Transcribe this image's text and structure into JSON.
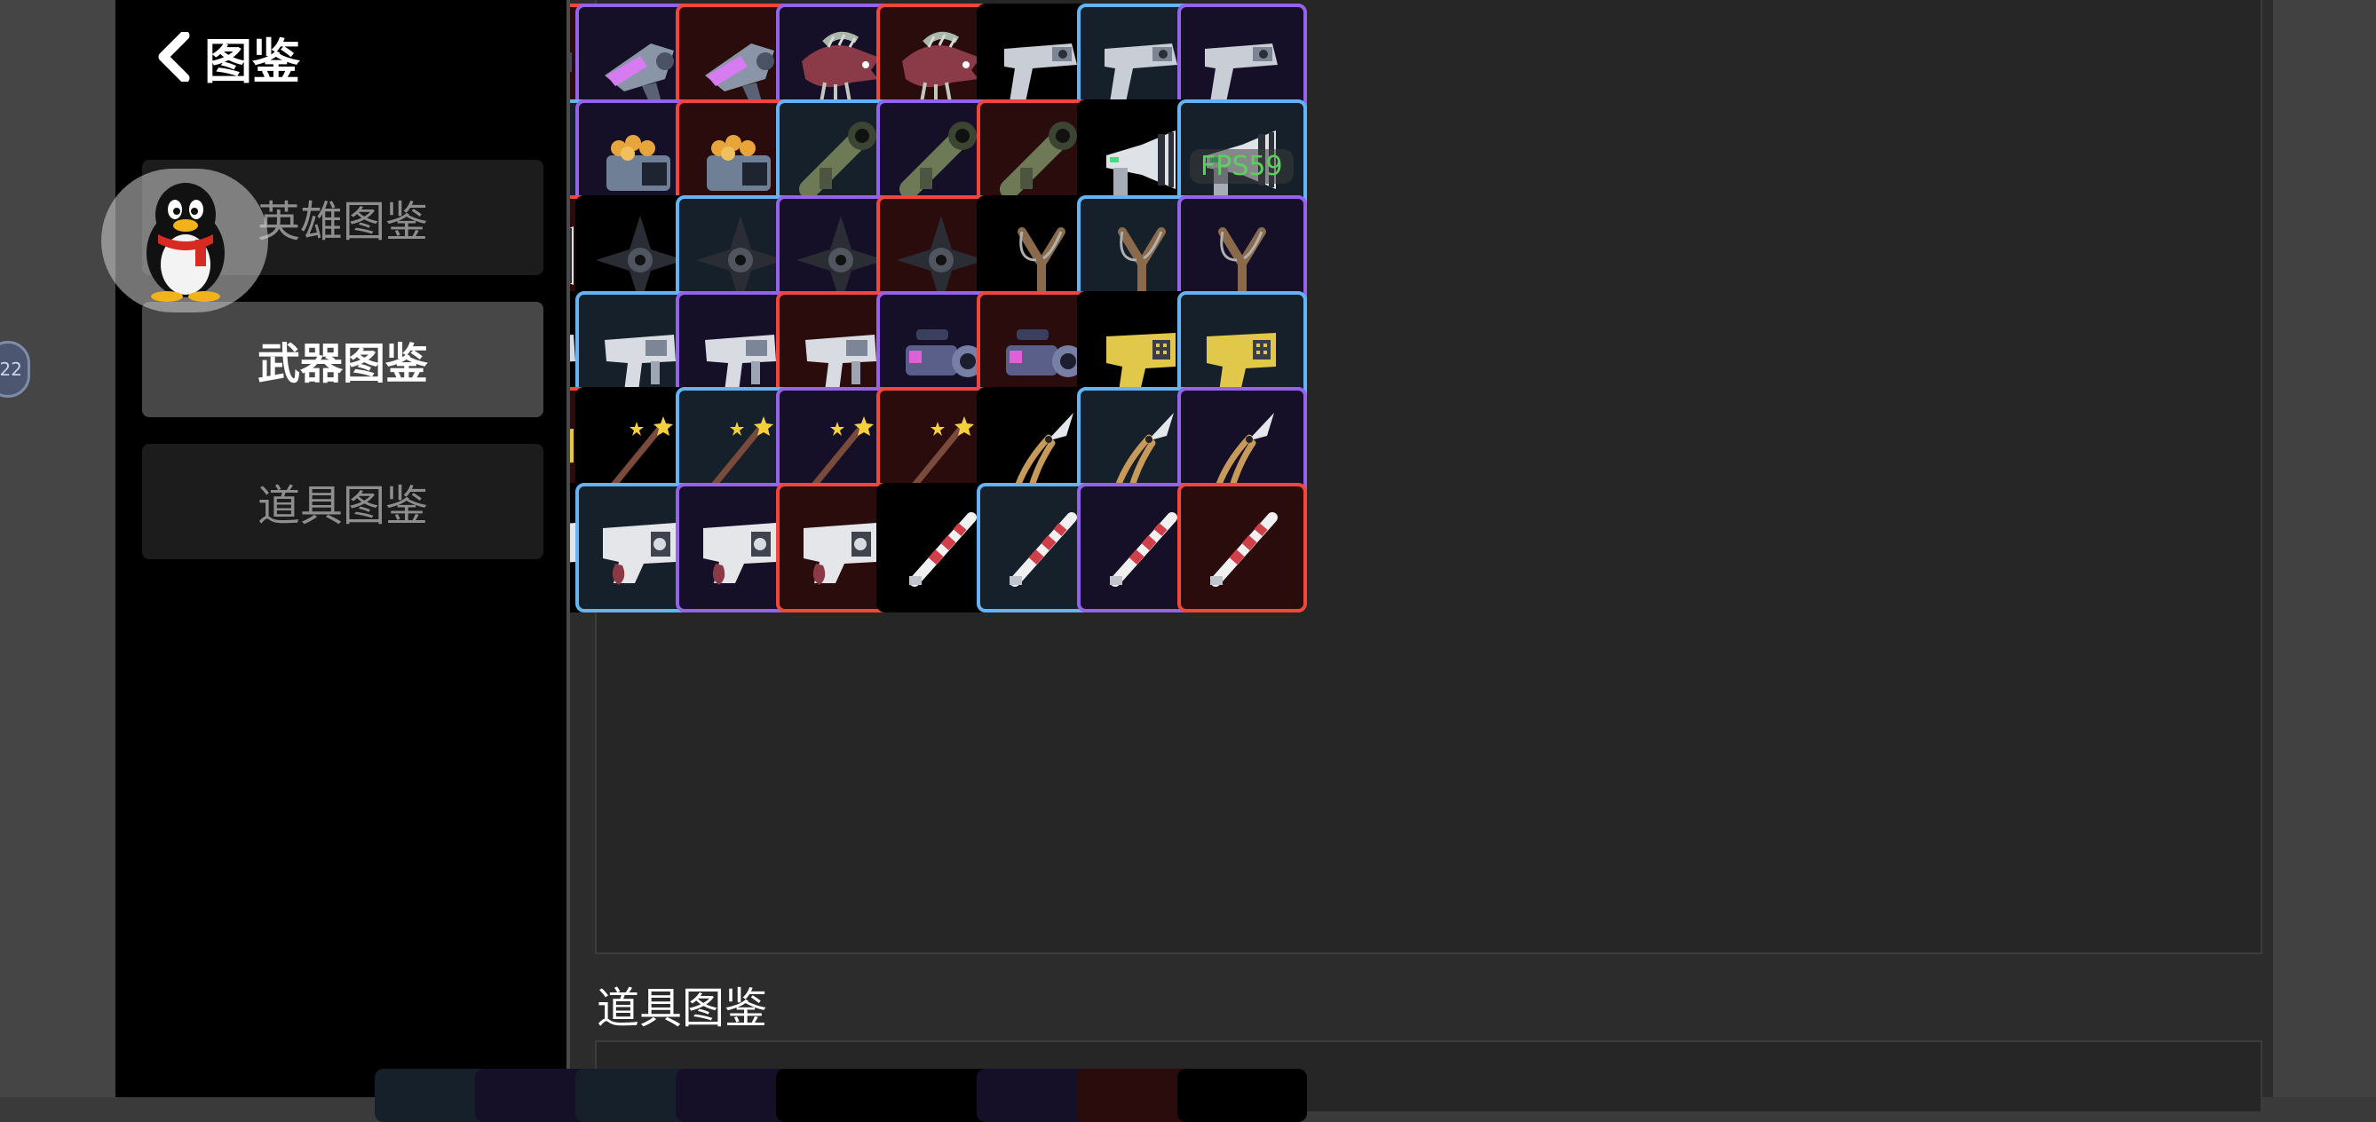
{
  "header": {
    "title": "图鉴"
  },
  "sidebar": {
    "items": [
      {
        "label": "英雄图鉴"
      },
      {
        "label": "武器图鉴"
      },
      {
        "label": "道具图鉴"
      }
    ]
  },
  "overlay": {
    "fps": "FPS59",
    "edge_badge": "22"
  },
  "section": {
    "items_title": "道具图鉴"
  },
  "rarity_colors": {
    "gray": "#000000",
    "blue": "#63b3f5",
    "purple": "#9463ea",
    "red": "#f2453c"
  },
  "weapon_grid": [
    [
      {
        "icon": "gatling-gun-icon",
        "rarity": "purple"
      },
      {
        "icon": "gatling-gun-icon",
        "rarity": "red"
      },
      {
        "icon": "laser-blaster-icon",
        "rarity": "purple"
      },
      {
        "icon": "laser-blaster-icon",
        "rarity": "red"
      },
      {
        "icon": "dragon-gun-icon",
        "rarity": "purple"
      },
      {
        "icon": "dragon-gun-icon",
        "rarity": "red"
      },
      {
        "icon": "pistol-icon",
        "rarity": "gray"
      },
      {
        "icon": "pistol-icon",
        "rarity": "blue"
      },
      {
        "icon": "pistol-icon",
        "rarity": "purple"
      }
    ],
    [
      {
        "icon": "pistol-icon",
        "rarity": "red"
      },
      {
        "icon": "grenade-launcher-icon",
        "rarity": "blue"
      },
      {
        "icon": "grenade-launcher-icon",
        "rarity": "purple"
      },
      {
        "icon": "grenade-launcher-icon",
        "rarity": "red"
      },
      {
        "icon": "bazooka-icon",
        "rarity": "blue"
      },
      {
        "icon": "bazooka-icon",
        "rarity": "purple"
      },
      {
        "icon": "bazooka-icon",
        "rarity": "red"
      },
      {
        "icon": "megaphone-gun-icon",
        "rarity": "gray"
      },
      {
        "icon": "megaphone-gun-icon",
        "rarity": "blue"
      }
    ],
    [
      {
        "icon": "megaphone-gun-icon",
        "rarity": "purple"
      },
      {
        "icon": "megaphone-gun-icon",
        "rarity": "red"
      },
      {
        "icon": "shuriken-icon",
        "rarity": "gray"
      },
      {
        "icon": "shuriken-icon",
        "rarity": "blue"
      },
      {
        "icon": "shuriken-icon",
        "rarity": "purple"
      },
      {
        "icon": "shuriken-icon",
        "rarity": "red"
      },
      {
        "icon": "slingshot-icon",
        "rarity": "gray"
      },
      {
        "icon": "slingshot-icon",
        "rarity": "blue"
      },
      {
        "icon": "slingshot-icon",
        "rarity": "purple"
      }
    ],
    [
      {
        "icon": "slingshot-icon",
        "rarity": "red"
      },
      {
        "icon": "smg-icon",
        "rarity": "gray"
      },
      {
        "icon": "smg-icon",
        "rarity": "blue"
      },
      {
        "icon": "smg-icon",
        "rarity": "purple"
      },
      {
        "icon": "smg-icon",
        "rarity": "red"
      },
      {
        "icon": "scoped-cannon-icon",
        "rarity": "purple"
      },
      {
        "icon": "scoped-cannon-icon",
        "rarity": "red"
      },
      {
        "icon": "taser-icon",
        "rarity": "gray"
      },
      {
        "icon": "taser-icon",
        "rarity": "blue"
      }
    ],
    [
      {
        "icon": "taser-icon",
        "rarity": "purple"
      },
      {
        "icon": "taser-icon",
        "rarity": "red"
      },
      {
        "icon": "magic-wand-icon",
        "rarity": "gray"
      },
      {
        "icon": "magic-wand-icon",
        "rarity": "blue"
      },
      {
        "icon": "magic-wand-icon",
        "rarity": "purple"
      },
      {
        "icon": "magic-wand-icon",
        "rarity": "red"
      },
      {
        "icon": "pruning-shears-icon",
        "rarity": "gray"
      },
      {
        "icon": "pruning-shears-icon",
        "rarity": "blue"
      },
      {
        "icon": "pruning-shears-icon",
        "rarity": "purple"
      }
    ],
    [
      {
        "icon": "pruning-shears-icon",
        "rarity": "red"
      },
      {
        "icon": "blaster-pistol-icon",
        "rarity": "gray"
      },
      {
        "icon": "blaster-pistol-icon",
        "rarity": "blue"
      },
      {
        "icon": "blaster-pistol-icon",
        "rarity": "purple"
      },
      {
        "icon": "blaster-pistol-icon",
        "rarity": "red"
      },
      {
        "icon": "drill-lance-icon",
        "rarity": "gray"
      },
      {
        "icon": "drill-lance-icon",
        "rarity": "blue"
      },
      {
        "icon": "drill-lance-icon",
        "rarity": "purple"
      },
      {
        "icon": "drill-lance-icon",
        "rarity": "red"
      }
    ]
  ],
  "item_grid_peek": [
    "blue",
    "purple",
    "blue",
    "purple",
    "gray",
    "gray",
    "purple",
    "red",
    "gray"
  ]
}
